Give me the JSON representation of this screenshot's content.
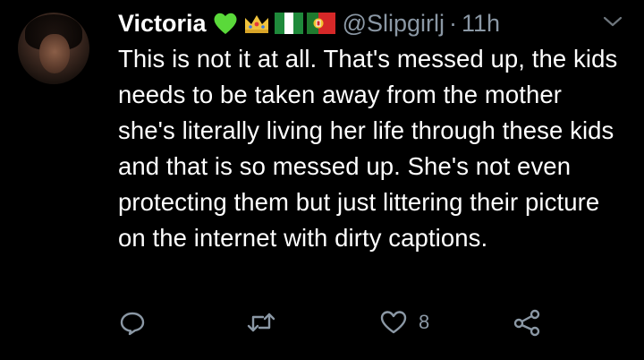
{
  "tweet": {
    "display_name": "Victoria",
    "badges": [
      "green-heart-icon",
      "crown-icon",
      "nigeria-flag-icon",
      "portugal-flag-icon"
    ],
    "handle": "@Slipgirlj",
    "separator": "·",
    "time": "11h",
    "text": "This is not it at all. That's messed up, the kids needs to be taken away from the mother she's literally living her life through these kids and that is so messed up. She's not even protecting them but just littering their picture on the internet with dirty captions.",
    "likes": "8"
  },
  "actions": [
    "reply-icon",
    "retweet-icon",
    "like-icon",
    "share-icon"
  ],
  "colors": {
    "background": "#000000",
    "text": "#ffffff",
    "secondary": "#8b98a5"
  }
}
